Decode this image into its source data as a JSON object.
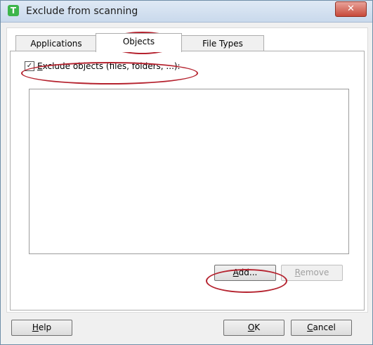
{
  "window": {
    "title": "Exclude from scanning",
    "app_icon_letter": "T",
    "close_glyph": "✕"
  },
  "tabs": [
    {
      "label": "Applications"
    },
    {
      "label": "Objects"
    },
    {
      "label": "File Types"
    }
  ],
  "objects_panel": {
    "exclude_checkbox": {
      "checked": true,
      "mark": "✓",
      "label_mnemonic": "E",
      "label_rest": "xclude objects (files, folders, ...):"
    },
    "list_items": []
  },
  "buttons": {
    "add": {
      "mnemonic": "A",
      "rest": "dd..."
    },
    "remove": {
      "mnemonic": "R",
      "rest": "emove"
    },
    "help": {
      "mnemonic": "H",
      "rest": "elp"
    },
    "ok": {
      "mnemonic": "O",
      "rest": "K"
    },
    "cancel": {
      "mnemonic": "C",
      "rest": "ancel"
    }
  },
  "colors": {
    "highlight_ellipse": "#b5232f",
    "close_button": "#c74a3a",
    "app_icon": "#3cb54a"
  }
}
